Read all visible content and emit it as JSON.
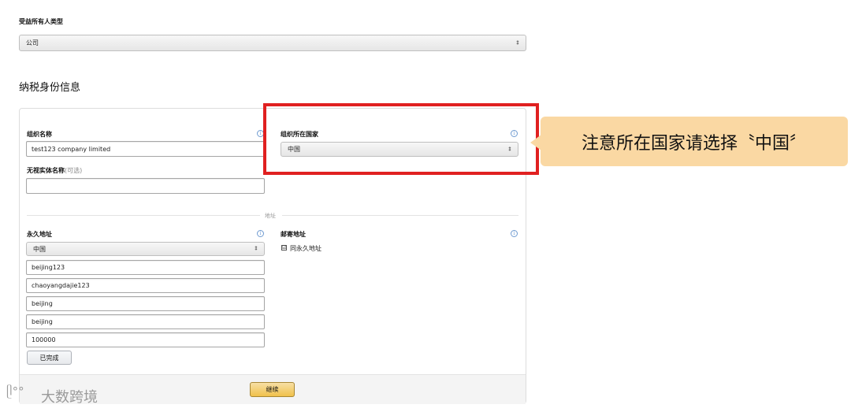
{
  "owner_type": {
    "label": "受益所有人类型",
    "value": "公司"
  },
  "section_title": "纳税身份信息",
  "org": {
    "name_label": "组织名称",
    "name_value": "test123 company limited",
    "country_label": "组织所在国家",
    "country_value": "中国",
    "disregarded_label": "无视实体名称",
    "disregarded_optional": "(可选)",
    "disregarded_value": ""
  },
  "address": {
    "divider_label": "地址",
    "permanent_label": "永久地址",
    "country_value": "中国",
    "lines": [
      "beijing123",
      "chaoyangdajie123",
      "beijing",
      "beijing",
      "100000"
    ],
    "done_button": "已完成",
    "mailing_label": "邮寄地址",
    "same_as_checkbox": "☑",
    "same_as_label": "同永久地址"
  },
  "continue_button": "继续",
  "annotation": {
    "callout_text": "注意所在国家请选择〝中国〞"
  },
  "watermark": {
    "logo_glyph": "ᥫ°°",
    "text": "大数跨境"
  },
  "icons": {
    "info": "i",
    "select_arrow": "⇕"
  },
  "colors": {
    "highlight_border": "#e02020",
    "callout_bg": "#fad8a3",
    "primary_button": "#f0c14b"
  }
}
